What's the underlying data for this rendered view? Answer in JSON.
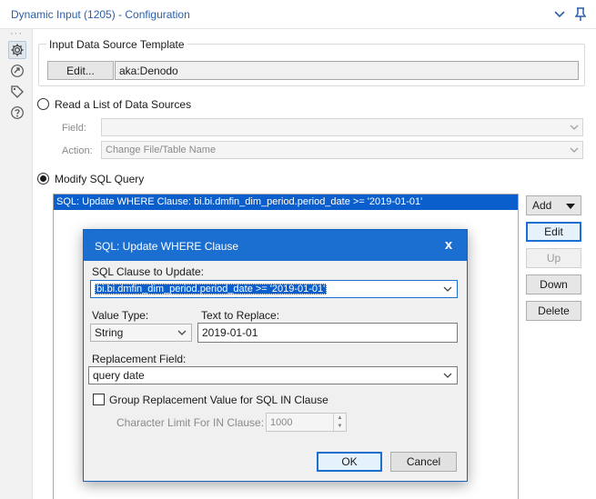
{
  "window": {
    "title": "Dynamic Input (1205) - Configuration",
    "collapse_icon": "chevron-down-icon",
    "pin_icon": "pin-icon"
  },
  "rail": {
    "dots": "···",
    "items": [
      {
        "icon": "gear-icon",
        "active": true
      },
      {
        "icon": "connection-icon",
        "active": false
      },
      {
        "icon": "tag-icon",
        "active": false
      },
      {
        "icon": "help-icon",
        "active": false
      }
    ]
  },
  "template": {
    "group_label": "Input Data Source Template",
    "edit_label": "Edit...",
    "source_value": "aka:Denodo"
  },
  "read_list": {
    "label": "Read a List of Data Sources",
    "selected": false,
    "field_label": "Field:",
    "field_value": "",
    "action_label": "Action:",
    "action_value": "Change File/Table Name"
  },
  "modify_sql": {
    "label": "Modify SQL Query",
    "selected": true,
    "rows": [
      "SQL: Update WHERE Clause:  bi.bi.dmfin_dim_period.period_date >= '2019-01-01'"
    ]
  },
  "side_buttons": {
    "add": "Add",
    "edit": "Edit",
    "up": "Up",
    "down": "Down",
    "delete": "Delete"
  },
  "dialog": {
    "title": "SQL: Update WHERE Clause",
    "close_glyph": "x",
    "clause_label": "SQL Clause to Update:",
    "clause_value": "bi.bi.dmfin_dim_period.period_date >= '2019-01-01'",
    "value_type_label": "Value Type:",
    "value_type_value": "String",
    "text_replace_label": "Text to Replace:",
    "text_replace_value": "2019-01-01",
    "replacement_label": "Replacement Field:",
    "replacement_value": "query date",
    "group_checkbox_label": "Group Replacement Value for SQL IN Clause",
    "group_checked": false,
    "char_limit_label": "Character Limit For IN Clause:",
    "char_limit_value": "1000",
    "ok_label": "OK",
    "cancel_label": "Cancel"
  },
  "colors": {
    "accent": "#1a6fd1",
    "title": "#2a5fa8",
    "selection": "#0a5fcc"
  }
}
